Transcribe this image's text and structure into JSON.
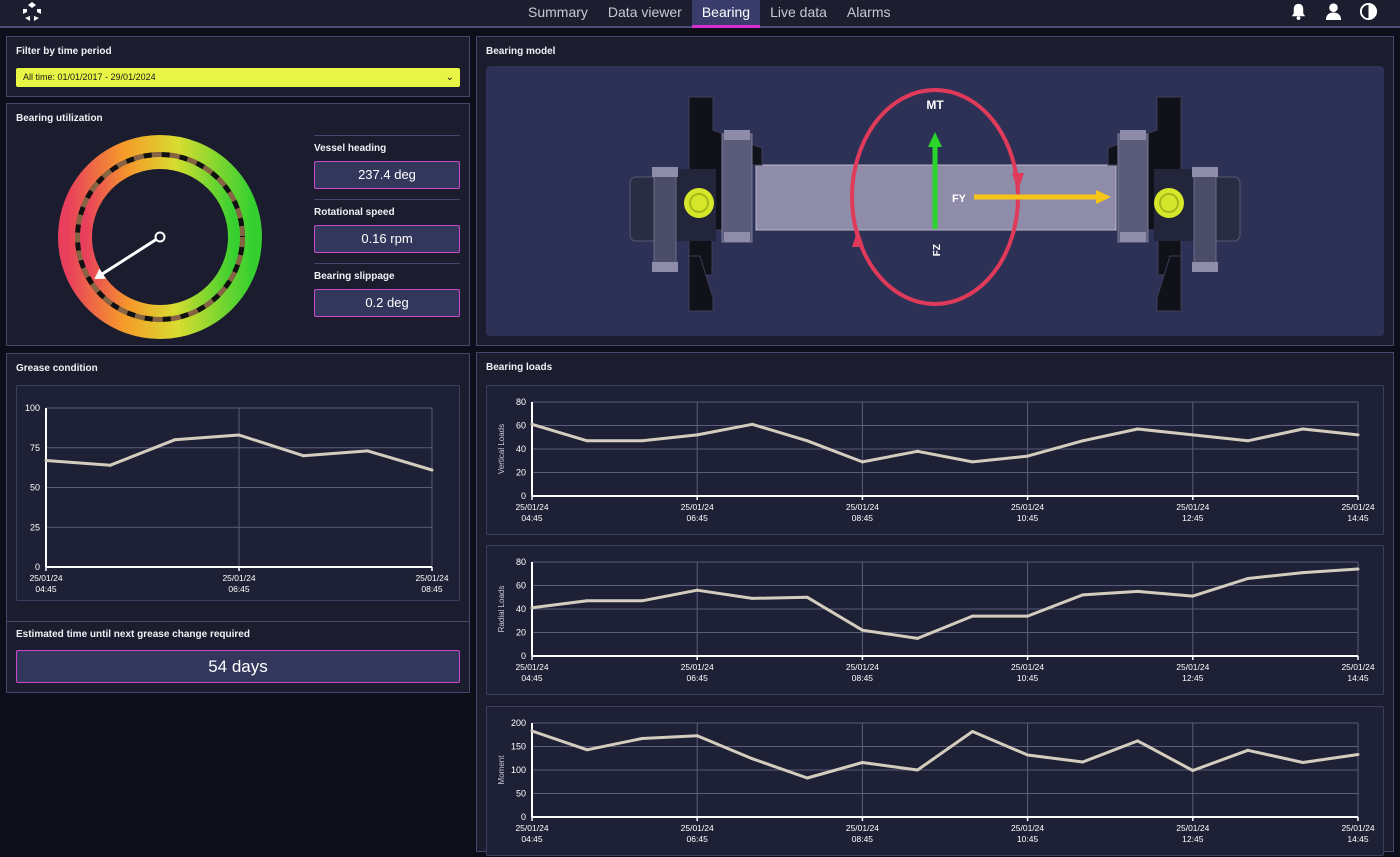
{
  "nav": {
    "tabs": [
      "Summary",
      "Data viewer",
      "Bearing",
      "Live data",
      "Alarms"
    ],
    "active_index": 2
  },
  "icons": {
    "logo": "logo-icon",
    "bell": "bell-icon",
    "user": "user-icon",
    "theme": "contrast-icon"
  },
  "filter": {
    "title": "Filter by time period",
    "value": "All time: 01/01/2017 - 29/01/2024"
  },
  "utilization": {
    "title": "Bearing utilization",
    "metrics": [
      {
        "label": "Vessel heading",
        "value": "237.4 deg"
      },
      {
        "label": "Rotational speed",
        "value": "0.16 rpm"
      },
      {
        "label": "Bearing slippage",
        "value": "0.2 deg"
      }
    ],
    "needle_heading_deg": 237.4
  },
  "model": {
    "title": "Bearing model",
    "labels": {
      "mt": "MT",
      "fy": "FY",
      "fz": "FZ"
    }
  },
  "grease": {
    "title": "Grease condition",
    "estimate_label": "Estimated time until next grease change required",
    "estimate_value": "54 days"
  },
  "loads": {
    "title": "Bearing loads"
  },
  "colors": {
    "accent": "#d52fd4",
    "select": "#e8f545",
    "line": "#d4cdbe",
    "green": "#2bd42b",
    "yellow": "#f5c518",
    "red": "#e03a5a"
  },
  "chart_data": [
    {
      "id": "grease",
      "type": "line",
      "x": [
        "25/01/24 04:45",
        "",
        "",
        "",
        "",
        "25/01/24 06:45",
        "",
        "",
        "",
        "",
        "25/01/24 08:45"
      ],
      "xticks": [
        0,
        5,
        10
      ],
      "values": [
        67,
        64,
        80,
        83,
        70,
        73,
        61
      ],
      "ylabel": "",
      "ylim": [
        0,
        100
      ],
      "yticks": [
        0,
        25,
        50,
        75,
        100
      ],
      "xtick_labels": [
        [
          "25/01/24",
          "04:45"
        ],
        [
          "25/01/24",
          "06:45"
        ],
        [
          "25/01/24",
          "08:45"
        ]
      ]
    },
    {
      "id": "vertical",
      "type": "line",
      "values": [
        61,
        47,
        47,
        52,
        61,
        47,
        29,
        38,
        29,
        34,
        47,
        57,
        52,
        47,
        57,
        52
      ],
      "ylabel": "Vertical Loads",
      "ylim": [
        0,
        80
      ],
      "yticks": [
        0,
        20,
        40,
        60,
        80
      ],
      "xtick_labels": [
        [
          "25/01/24",
          "04:45"
        ],
        [
          "25/01/24",
          "06:45"
        ],
        [
          "25/01/24",
          "08:45"
        ],
        [
          "25/01/24",
          "10:45"
        ],
        [
          "25/01/24",
          "12:45"
        ],
        [
          "25/01/24",
          "14:45"
        ]
      ]
    },
    {
      "id": "radial",
      "type": "line",
      "values": [
        41,
        47,
        47,
        56,
        49,
        50,
        22,
        15,
        34,
        34,
        52,
        55,
        51,
        66,
        71,
        74
      ],
      "ylabel": "Radial Loads",
      "ylim": [
        0,
        80
      ],
      "yticks": [
        0,
        20,
        40,
        60,
        80
      ],
      "xtick_labels": [
        [
          "25/01/24",
          "04:45"
        ],
        [
          "25/01/24",
          "06:45"
        ],
        [
          "25/01/24",
          "08:45"
        ],
        [
          "25/01/24",
          "10:45"
        ],
        [
          "25/01/24",
          "12:45"
        ],
        [
          "25/01/24",
          "14:45"
        ]
      ]
    },
    {
      "id": "moment",
      "type": "line",
      "values": [
        183,
        143,
        167,
        173,
        124,
        83,
        116,
        100,
        182,
        132,
        117,
        162,
        99,
        142,
        116,
        133
      ],
      "ylabel": "Moment",
      "ylim": [
        0,
        200
      ],
      "yticks": [
        0,
        50,
        100,
        150,
        200
      ],
      "xtick_labels": [
        [
          "25/01/24",
          "04:45"
        ],
        [
          "25/01/24",
          "06:45"
        ],
        [
          "25/01/24",
          "08:45"
        ],
        [
          "25/01/24",
          "10:45"
        ],
        [
          "25/01/24",
          "12:45"
        ],
        [
          "25/01/24",
          "14:45"
        ]
      ]
    }
  ]
}
